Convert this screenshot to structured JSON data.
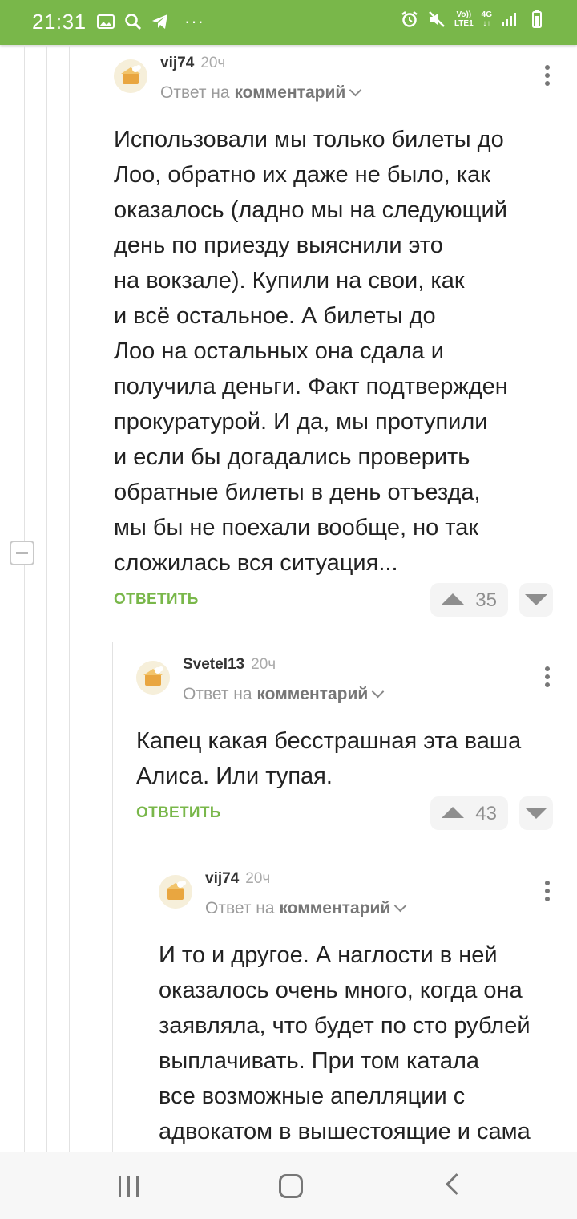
{
  "status_bar": {
    "time": "21:31",
    "left_icons": [
      "gallery-icon",
      "search-icon",
      "telegram-icon"
    ],
    "more": "···",
    "volte": "Vo))",
    "lte": "LTE1",
    "net": "4G",
    "right_icons": [
      "alarm-icon",
      "mute-icon",
      "signal-icon",
      "battery-icon"
    ]
  },
  "comments": [
    {
      "username": "vij74",
      "time": "20ч",
      "reply_prefix": "Ответ на",
      "reply_target": "комментарий",
      "lines": [
        "Использовали мы только билеты до",
        "Лоо, обратно их даже не было, как",
        "оказалось (ладно мы на следующий",
        "день по приезду выяснили это",
        "на вокзале). Купили на свои, как",
        "и всё остальное. А билеты до",
        "Лоо на остальных она сдала и",
        "получила деньги. Факт подтвержден",
        "прокуратурой. И да, мы протупили",
        "и если бы догадались проверить",
        "обратные билеты в день отъезда,",
        "мы бы не поехали вообще, но так",
        "сложилась вся ситуация..."
      ],
      "reply_label": "ОТВЕТИТЬ",
      "rating": "35"
    },
    {
      "username": "Svetel13",
      "time": "20ч",
      "reply_prefix": "Ответ на",
      "reply_target": "комментарий",
      "lines": [
        "Капец какая бесстрашная эта ваша",
        "Алиса. Или тупая."
      ],
      "reply_label": "ОТВЕТИТЬ",
      "rating": "43"
    },
    {
      "username": "vij74",
      "time": "20ч",
      "reply_prefix": "Ответ на",
      "reply_target": "комментарий",
      "lines": [
        "И то и другое. А наглости в ней",
        "оказалось очень много, когда она",
        "заявляла, что будет по сто рублей",
        "выплачивать. При том катала",
        "все возможные апелляции с",
        "адвокатом в вышестоящие и сама"
      ]
    }
  ],
  "colors": {
    "brand_green": "#79b74a",
    "status_bar": "#79b74a",
    "vote_bg": "#f4f4f4"
  },
  "nav_bar": {
    "icons": [
      "recents-icon",
      "home-icon",
      "back-icon"
    ]
  }
}
